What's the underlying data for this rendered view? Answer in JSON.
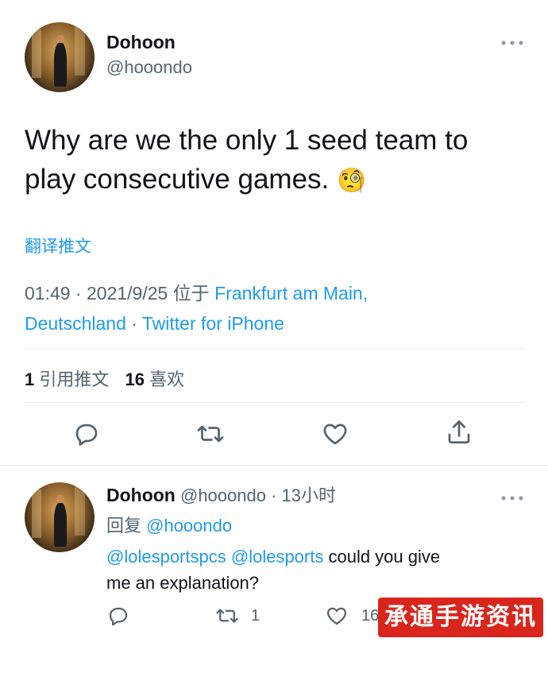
{
  "main_tweet": {
    "author_name": "Dohoon",
    "author_handle": "@hooondo",
    "text_line1": "Why are we the only 1 seed team to",
    "text_line2": "play consecutive games.",
    "emoji": "🧐",
    "translate_label": "翻译推文",
    "meta_time": "01:49 · 2021/9/25 位于 ",
    "location_line1": "Frankfurt am Main,",
    "location_line2": "Deutschland",
    "meta_sep": " · ",
    "source": "Twitter for iPhone",
    "retweet_count": "1",
    "retweet_label": "引用推文",
    "like_count": "16",
    "like_label": "喜欢"
  },
  "reply_tweet": {
    "author_name": "Dohoon",
    "author_handle": "@hooondo",
    "time": "· 13小时",
    "reply_prefix": "回复 ",
    "reply_to": "@hooondo",
    "mention1": "@lolesportspcs",
    "mention2": "@lolesports",
    "text_line1_rest": " could you give",
    "text_line2": "me an explanation?",
    "retweet_count": "1",
    "like_count": "16"
  },
  "watermark": "承通手游资讯网",
  "icons": [
    "reply-icon",
    "retweet-icon",
    "like-icon",
    "share-icon",
    "more-icon"
  ]
}
